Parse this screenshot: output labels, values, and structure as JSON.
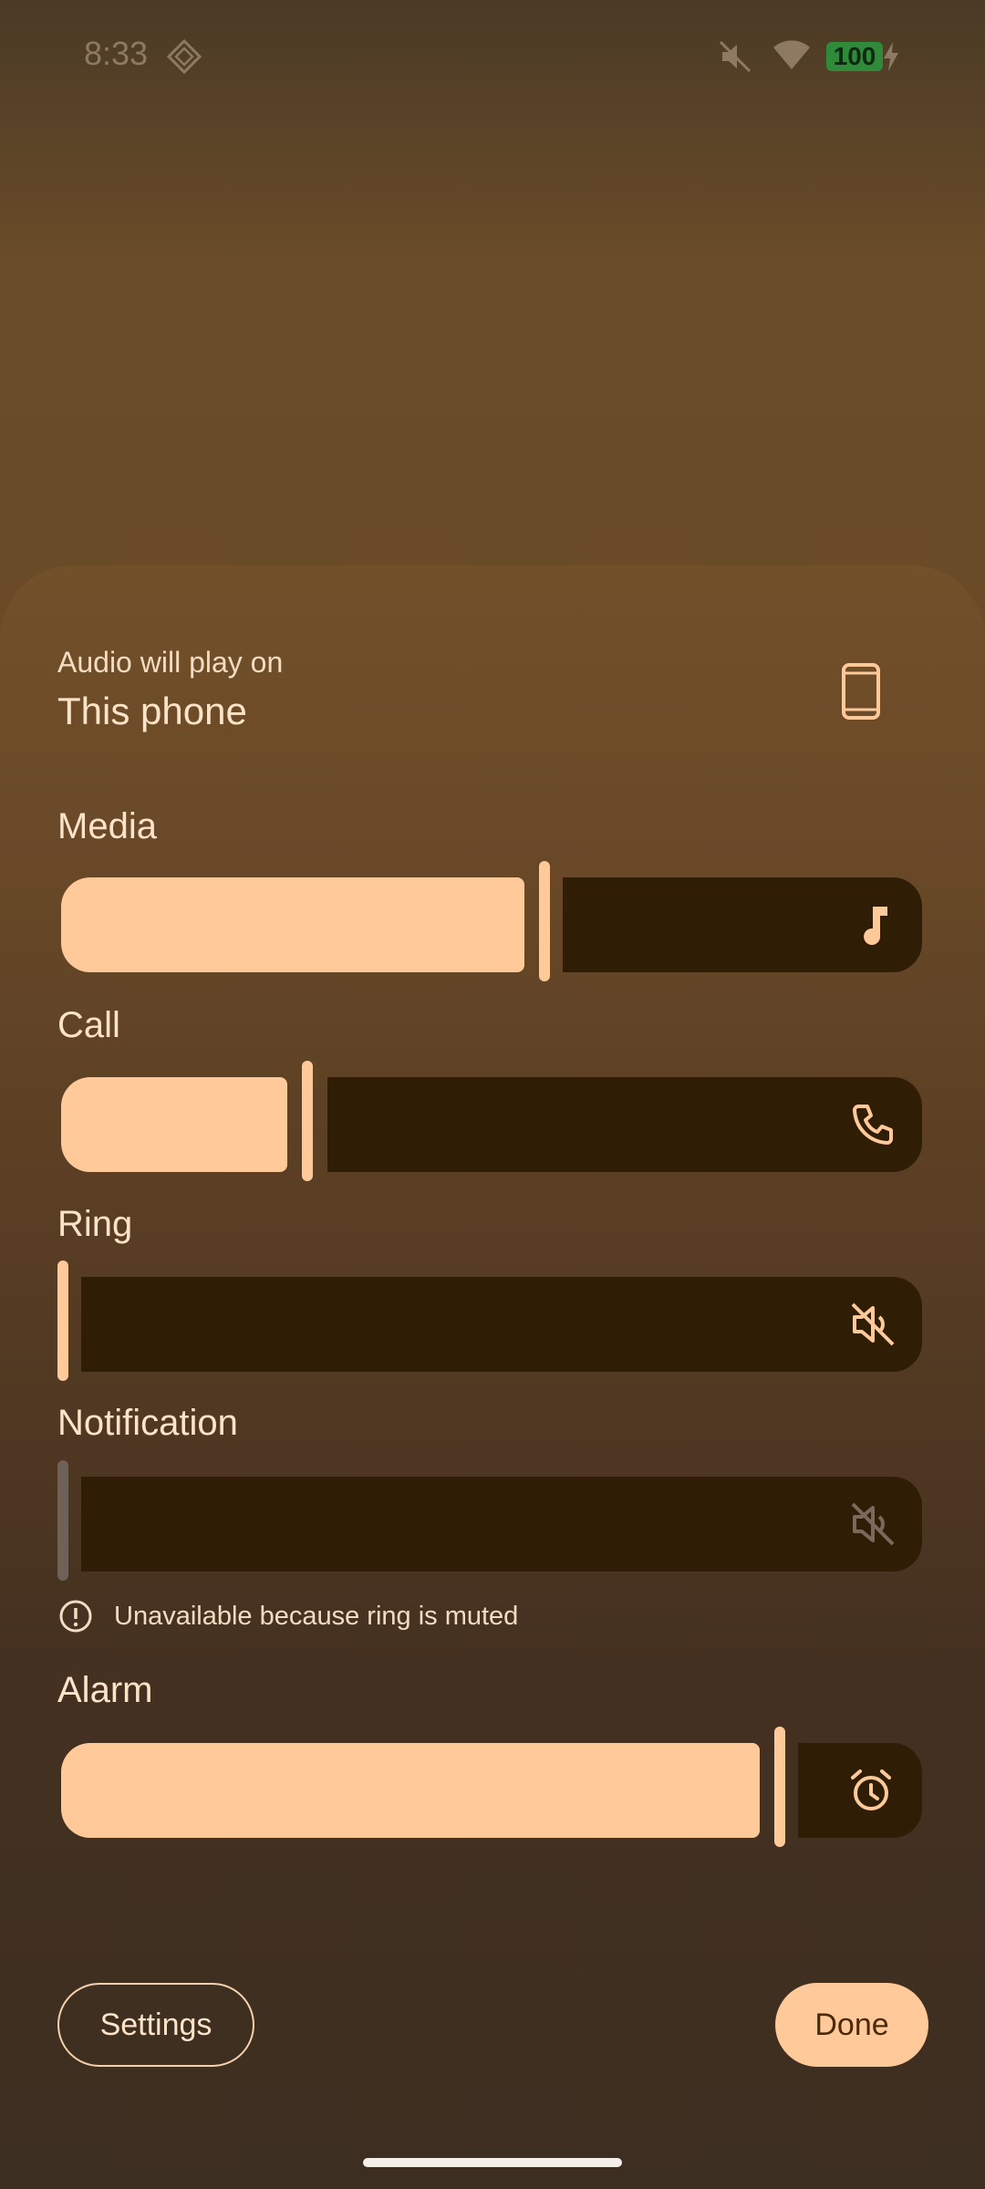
{
  "status_bar": {
    "time": "8:33",
    "battery": "100",
    "icons": [
      "assistant-diamond-icon",
      "mute-icon",
      "wifi-icon",
      "battery-icon",
      "charging-bolt-icon"
    ]
  },
  "audio_output": {
    "label": "Audio will play on",
    "device": "This phone",
    "icon": "phone-icon"
  },
  "sliders": {
    "media": {
      "title": "Media",
      "level": 0.55,
      "icon": "music-note-icon"
    },
    "call": {
      "title": "Call",
      "level": 0.27,
      "icon": "phone-call-icon"
    },
    "ring": {
      "title": "Ring",
      "level": 0.0,
      "icon": "volume-off-icon"
    },
    "notification": {
      "title": "Notification",
      "level": 0.0,
      "icon": "volume-off-icon",
      "disabled": true,
      "warning": "Unavailable because ring is muted"
    },
    "alarm": {
      "title": "Alarm",
      "level": 0.84,
      "icon": "alarm-clock-icon"
    }
  },
  "buttons": {
    "settings": "Settings",
    "done": "Done"
  },
  "colors": {
    "accent": "#ffc99a",
    "track": "#2f1d06",
    "text": "#fde3c8"
  }
}
